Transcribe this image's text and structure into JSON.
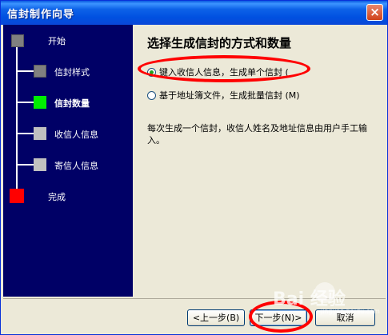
{
  "window": {
    "title": "信封制作向导",
    "close_glyph": "×"
  },
  "steps": [
    {
      "label": "开始",
      "state": "done",
      "color": "#808080"
    },
    {
      "label": "信封样式",
      "state": "done",
      "color": "#808080"
    },
    {
      "label": "信封数量",
      "state": "current",
      "color": "#00ee00"
    },
    {
      "label": "收信人信息",
      "state": "pending",
      "color": "#c0c0c0"
    },
    {
      "label": "寄信人信息",
      "state": "pending",
      "color": "#c0c0c0"
    },
    {
      "label": "完成",
      "state": "end",
      "color": "#ff0000"
    }
  ],
  "content": {
    "heading": "选择生成信封的方式和数量",
    "options": [
      {
        "label": "键入收信人信息，生成单个信封 (",
        "checked": true
      },
      {
        "label": "基于地址簿文件，生成批量信封 (M)",
        "checked": false
      }
    ],
    "description": "每次生成一个信封，收信人姓名及地址信息由用户手工输入。"
  },
  "buttons": {
    "back": "<上一步(B)",
    "next": "下一步(N)>",
    "cancel": "取消"
  },
  "watermark": {
    "text": "Bai 经验",
    "url": "jingyan.baidu.com"
  }
}
